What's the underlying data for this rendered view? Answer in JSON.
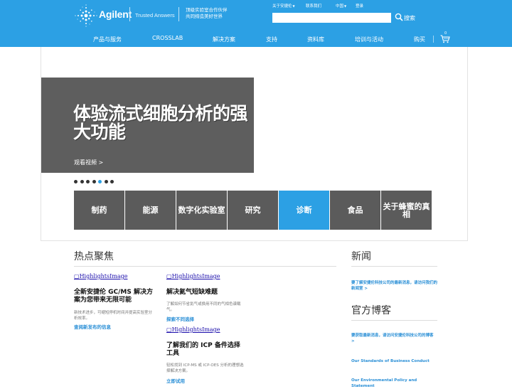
{
  "header": {
    "brand": "Agilent",
    "tagline": "Trusted Answers",
    "slogan_line1": "顶级实验室合作伙伴",
    "slogan_line2": "共同缔造美好世界",
    "utility": [
      {
        "label": "关于安捷伦",
        "has_caret": true
      },
      {
        "label": "联系我们",
        "has_caret": false
      },
      {
        "label": "中国",
        "has_caret": true
      },
      {
        "label": "登录",
        "has_caret": false
      }
    ],
    "search_placeholder": "",
    "search_label": "搜索",
    "cart_count": "0",
    "nav": [
      "产品与服务",
      "CROSSLAB",
      "解决方案",
      "支持",
      "资料库",
      "培训与活动",
      "购买"
    ]
  },
  "hero": {
    "title": "体验流式细胞分析的强大功能",
    "cta": "观看视频 >",
    "slide_count": 7,
    "active_slide": 5
  },
  "tiles": [
    {
      "label": "制药"
    },
    {
      "label": "能源"
    },
    {
      "label": "数字化实验室"
    },
    {
      "label": "研究"
    },
    {
      "label": "诊断",
      "active": true
    },
    {
      "label": "食品"
    },
    {
      "label": "关于蜂蜜的真相"
    }
  ],
  "highlights": {
    "title": "热点聚焦",
    "items": [
      {
        "image_alt": "HighlightsImage",
        "title": "全新安捷伦 GC/MS 解决方案为您带来无限可能",
        "desc": "新技术进步，可缩短停机时间并提高实验室分析效率。",
        "link": "查阅新发布的信息"
      },
      {
        "image_alt": "HighlightsImage",
        "title": "解决氦气短缺难题",
        "desc": "了解如何节省氦气或换用不同的气相色谱载气。",
        "link": "探索不同选择"
      },
      {
        "image_alt": "HighlightsImage",
        "title": "了解我们的 ICP 备件选择工具",
        "desc": "轻松找到 ICP-MS 或 ICP-OES 分析的理想选择解决方案。",
        "link": "立即试用"
      }
    ]
  },
  "news": {
    "title": "新闻",
    "link": "要了解安捷伦科技公司的最新消息，请访问我们的新闻室 >"
  },
  "blog": {
    "title": "官方博客",
    "link": "要获取最新消息，请访问安捷伦科技公司的博客 >",
    "items": [
      "Our Standards of Business Conduct",
      "Our Environmental Policy and Statement"
    ]
  },
  "colors": {
    "brand_blue": "#2ca0e4",
    "tile_gray": "#5b5b5b",
    "hero_gray": "#5e5e5e",
    "link_blue": "#2a8fd6"
  }
}
